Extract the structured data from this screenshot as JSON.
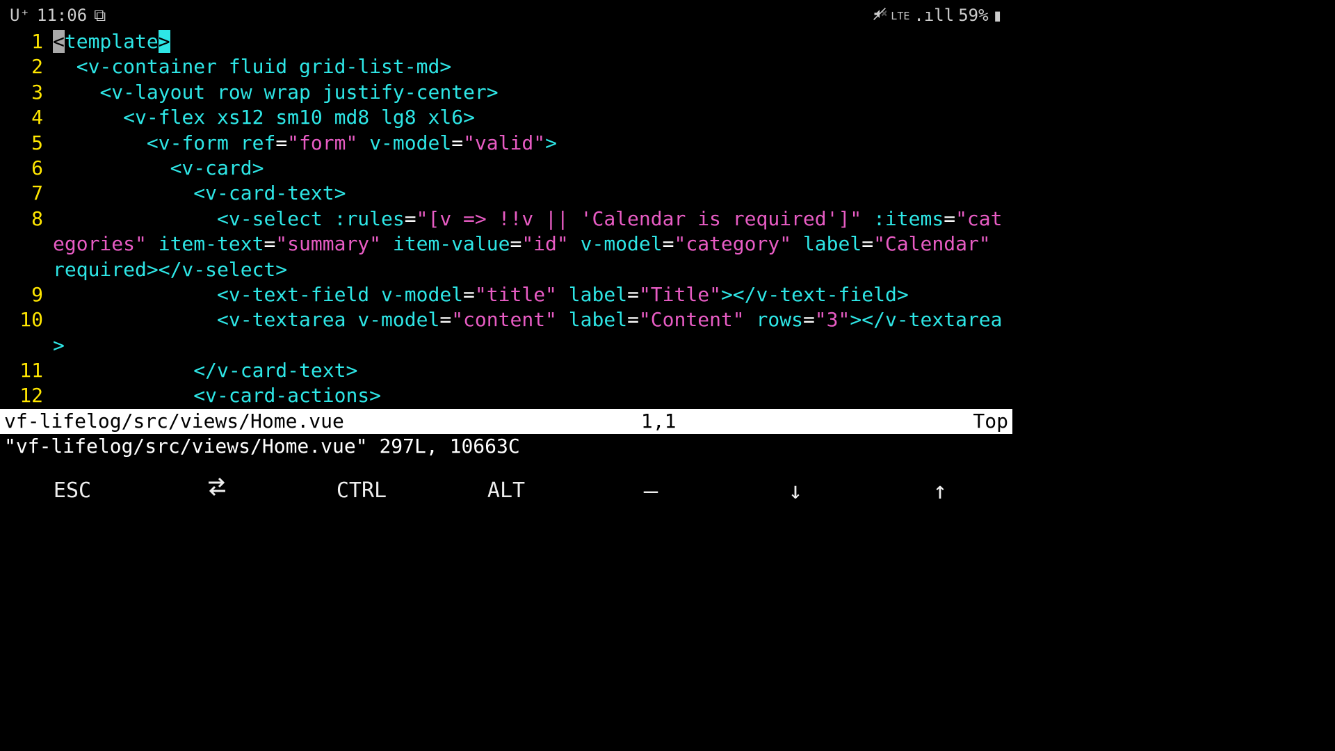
{
  "status_bar": {
    "carrier": "U⁺",
    "time": "11:06",
    "app_indicator": "⧉",
    "mute_icon": "🔇",
    "network": "LTE",
    "signal": ".ıll",
    "battery": "59%",
    "battery_icon": "▮"
  },
  "editor": {
    "lines": [
      {
        "n": "1",
        "tokens": [
          {
            "t": "<",
            "c": "cursor-block"
          },
          {
            "t": "template",
            "c": "c-tag"
          },
          {
            "t": ">",
            "c": "match-bracket"
          }
        ]
      },
      {
        "n": "2",
        "tokens": [
          {
            "t": "  ",
            "c": ""
          },
          {
            "t": "<v-container",
            "c": "c-tag"
          },
          {
            "t": " ",
            "c": ""
          },
          {
            "t": "fluid",
            "c": "c-attr"
          },
          {
            "t": " ",
            "c": ""
          },
          {
            "t": "grid-list-md",
            "c": "c-attr"
          },
          {
            "t": ">",
            "c": "c-tag"
          }
        ]
      },
      {
        "n": "3",
        "tokens": [
          {
            "t": "    ",
            "c": ""
          },
          {
            "t": "<v-layout",
            "c": "c-tag"
          },
          {
            "t": " ",
            "c": ""
          },
          {
            "t": "row",
            "c": "c-attr"
          },
          {
            "t": " ",
            "c": ""
          },
          {
            "t": "wrap",
            "c": "c-attr"
          },
          {
            "t": " ",
            "c": ""
          },
          {
            "t": "justify-center",
            "c": "c-attr"
          },
          {
            "t": ">",
            "c": "c-tag"
          }
        ]
      },
      {
        "n": "4",
        "tokens": [
          {
            "t": "      ",
            "c": ""
          },
          {
            "t": "<v-flex",
            "c": "c-tag"
          },
          {
            "t": " ",
            "c": ""
          },
          {
            "t": "xs12",
            "c": "c-attr"
          },
          {
            "t": " ",
            "c": ""
          },
          {
            "t": "sm10",
            "c": "c-attr"
          },
          {
            "t": " ",
            "c": ""
          },
          {
            "t": "md8",
            "c": "c-attr"
          },
          {
            "t": " ",
            "c": ""
          },
          {
            "t": "lg8",
            "c": "c-attr"
          },
          {
            "t": " ",
            "c": ""
          },
          {
            "t": "xl6",
            "c": "c-attr"
          },
          {
            "t": ">",
            "c": "c-tag"
          }
        ]
      },
      {
        "n": "5",
        "tokens": [
          {
            "t": "        ",
            "c": ""
          },
          {
            "t": "<v-form",
            "c": "c-tag"
          },
          {
            "t": " ",
            "c": ""
          },
          {
            "t": "ref",
            "c": "c-attr"
          },
          {
            "t": "=",
            "c": "c-punc"
          },
          {
            "t": "\"form\"",
            "c": "c-str"
          },
          {
            "t": " ",
            "c": ""
          },
          {
            "t": "v-model",
            "c": "c-attr"
          },
          {
            "t": "=",
            "c": "c-punc"
          },
          {
            "t": "\"valid\"",
            "c": "c-str"
          },
          {
            "t": ">",
            "c": "c-tag"
          }
        ]
      },
      {
        "n": "6",
        "tokens": [
          {
            "t": "          ",
            "c": ""
          },
          {
            "t": "<v-card>",
            "c": "c-tag"
          }
        ]
      },
      {
        "n": "7",
        "tokens": [
          {
            "t": "            ",
            "c": ""
          },
          {
            "t": "<v-card-text>",
            "c": "c-tag"
          }
        ]
      },
      {
        "n": "8",
        "tokens": [
          {
            "t": "              ",
            "c": ""
          },
          {
            "t": "<v-select",
            "c": "c-tag"
          },
          {
            "t": " ",
            "c": ""
          },
          {
            "t": ":rules",
            "c": "c-attr"
          },
          {
            "t": "=",
            "c": "c-punc"
          },
          {
            "t": "\"[v => !!v || 'Calendar is required']\"",
            "c": "c-str"
          },
          {
            "t": " ",
            "c": ""
          },
          {
            "t": ":items",
            "c": "c-attr"
          },
          {
            "t": "=",
            "c": "c-punc"
          },
          {
            "t": "\"categories\"",
            "c": "c-str"
          },
          {
            "t": " ",
            "c": ""
          },
          {
            "t": "item-text",
            "c": "c-attr"
          },
          {
            "t": "=",
            "c": "c-punc"
          },
          {
            "t": "\"summary\"",
            "c": "c-str"
          },
          {
            "t": " ",
            "c": ""
          },
          {
            "t": "item-value",
            "c": "c-attr"
          },
          {
            "t": "=",
            "c": "c-punc"
          },
          {
            "t": "\"id\"",
            "c": "c-str"
          },
          {
            "t": " ",
            "c": ""
          },
          {
            "t": "v-model",
            "c": "c-attr"
          },
          {
            "t": "=",
            "c": "c-punc"
          },
          {
            "t": "\"category\"",
            "c": "c-str"
          },
          {
            "t": " ",
            "c": ""
          },
          {
            "t": "label",
            "c": "c-attr"
          },
          {
            "t": "=",
            "c": "c-punc"
          },
          {
            "t": "\"Calendar\"",
            "c": "c-str"
          },
          {
            "t": " ",
            "c": ""
          },
          {
            "t": "required",
            "c": "c-attr"
          },
          {
            "t": "></v-select>",
            "c": "c-tag"
          }
        ]
      },
      {
        "n": "9",
        "tokens": [
          {
            "t": "              ",
            "c": ""
          },
          {
            "t": "<v-text-field",
            "c": "c-tag"
          },
          {
            "t": " ",
            "c": ""
          },
          {
            "t": "v-model",
            "c": "c-attr"
          },
          {
            "t": "=",
            "c": "c-punc"
          },
          {
            "t": "\"title\"",
            "c": "c-str"
          },
          {
            "t": " ",
            "c": ""
          },
          {
            "t": "label",
            "c": "c-attr"
          },
          {
            "t": "=",
            "c": "c-punc"
          },
          {
            "t": "\"Title\"",
            "c": "c-str"
          },
          {
            "t": "></v-text-field>",
            "c": "c-tag"
          }
        ]
      },
      {
        "n": "10",
        "tokens": [
          {
            "t": "              ",
            "c": ""
          },
          {
            "t": "<v-textarea",
            "c": "c-tag"
          },
          {
            "t": " ",
            "c": ""
          },
          {
            "t": "v-model",
            "c": "c-attr"
          },
          {
            "t": "=",
            "c": "c-punc"
          },
          {
            "t": "\"content\"",
            "c": "c-str"
          },
          {
            "t": " ",
            "c": ""
          },
          {
            "t": "label",
            "c": "c-attr"
          },
          {
            "t": "=",
            "c": "c-punc"
          },
          {
            "t": "\"Content\"",
            "c": "c-str"
          },
          {
            "t": " ",
            "c": ""
          },
          {
            "t": "rows",
            "c": "c-attr"
          },
          {
            "t": "=",
            "c": "c-punc"
          },
          {
            "t": "\"3\"",
            "c": "c-str"
          },
          {
            "t": "></v-textarea>",
            "c": "c-tag"
          }
        ]
      },
      {
        "n": "11",
        "tokens": [
          {
            "t": "            ",
            "c": ""
          },
          {
            "t": "</v-card-text>",
            "c": "c-tag"
          }
        ]
      },
      {
        "n": "12",
        "tokens": [
          {
            "t": "            ",
            "c": ""
          },
          {
            "t": "<v-card-actions>",
            "c": "c-tag"
          }
        ]
      }
    ]
  },
  "status_line": {
    "file": "vf-lifelog/src/views/Home.vue",
    "pos": "1,1",
    "scroll": "Top"
  },
  "cmd_line": "\"vf-lifelog/src/views/Home.vue\" 297L, 10663C",
  "keyrow": {
    "esc": "ESC",
    "tab": "⇄",
    "ctrl": "CTRL",
    "alt": "ALT",
    "dash": "—",
    "down": "↓",
    "up": "↑"
  }
}
